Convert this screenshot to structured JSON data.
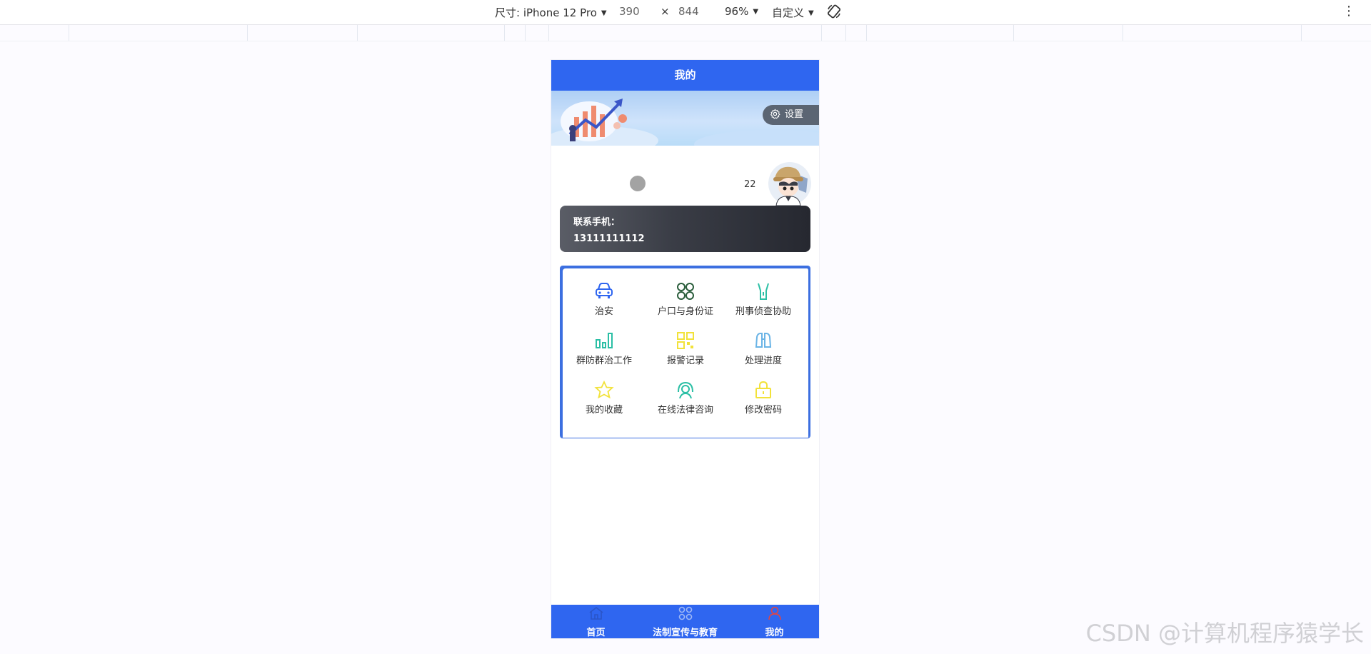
{
  "devtools": {
    "dimensions_label": "尺寸: iPhone 12 Pro",
    "width": "390",
    "times": "×",
    "height": "844",
    "zoom": "96%",
    "throttle": "自定义",
    "menu_glyph": "⋮"
  },
  "app": {
    "title": "我的",
    "settings_label": "设置",
    "profile": {
      "age": "22",
      "contact_label": "联系手机：",
      "contact_phone": "13111111112"
    },
    "grid": [
      {
        "label": "治安",
        "icon": "police-car-icon",
        "color": "#2f66f0"
      },
      {
        "label": "户口与身份证",
        "icon": "four-circles-icon",
        "color": "#2b5e3c"
      },
      {
        "label": "刑事侦查协助",
        "icon": "flashlight-icon",
        "color": "#2bbfa5"
      },
      {
        "label": "群防群治工作",
        "icon": "bar-chart-icon",
        "color": "#2bbfa5"
      },
      {
        "label": "报警记录",
        "icon": "qr-grid-icon",
        "color": "#f2e23a"
      },
      {
        "label": "处理进度",
        "icon": "binoculars-icon",
        "color": "#6ab4e6"
      },
      {
        "label": "我的收藏",
        "icon": "star-icon",
        "color": "#f2e23a"
      },
      {
        "label": "在线法律咨询",
        "icon": "headset-icon",
        "color": "#2bbfa5"
      },
      {
        "label": "修改密码",
        "icon": "lock-icon",
        "color": "#f2e23a"
      }
    ],
    "tabbar": [
      {
        "label": "首页",
        "icon": "home-icon",
        "color": "#2a55c8"
      },
      {
        "label": "法制宣传与教育",
        "icon": "command-icon",
        "color": "#9fb8f5"
      },
      {
        "label": "我的",
        "icon": "user-icon",
        "color": "#e04545",
        "active": true
      }
    ]
  },
  "watermark": "CSDN @计算机程序猿学长"
}
